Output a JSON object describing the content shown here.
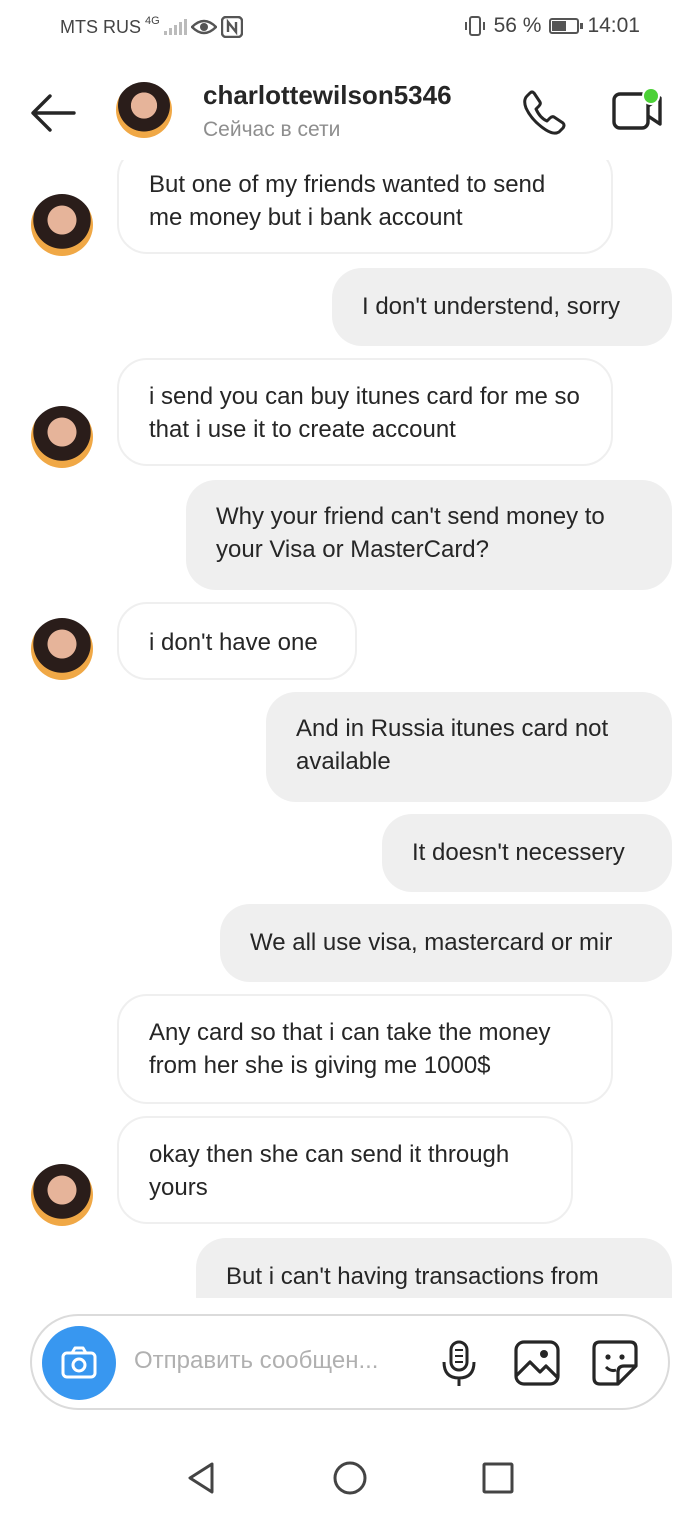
{
  "status_bar": {
    "carrier": "MTS RUS",
    "network": "4G",
    "battery": "56 %",
    "battery_level": 0.56,
    "time": "14:01"
  },
  "header": {
    "username": "charlottewilson5346",
    "presence": "Сейчас в сети",
    "online_dot_color": "#4cd137"
  },
  "messages": [
    {
      "side": "in",
      "text": "But one of my friends wanted to send me money but i bank account",
      "avatar": true
    },
    {
      "side": "out",
      "text": "I don't understend, sorry"
    },
    {
      "side": "in",
      "text": "i send you can buy itunes card for me so that i use it to create account",
      "avatar": true
    },
    {
      "side": "out",
      "text": "Why your friend can't send money to your Visa or MasterCard?"
    },
    {
      "side": "in",
      "text": "i don't have one",
      "avatar": true
    },
    {
      "side": "out",
      "text": "And in Russia itunes card not available"
    },
    {
      "side": "out",
      "text": "It doesn't necessery"
    },
    {
      "side": "out",
      "text": "We all use visa, mastercard or mir"
    },
    {
      "side": "in",
      "text": "Any card so that i can take the money from her she is giving me 1000$",
      "avatar": false
    },
    {
      "side": "in",
      "text": "okay then she can send it through yours",
      "avatar": true
    },
    {
      "side": "out",
      "text": "But i can't having transactions from"
    }
  ],
  "composer": {
    "placeholder": "Отправить сообщен...",
    "value": "",
    "camera_color": "#3897f0"
  },
  "icons": {
    "back": "arrow-left-icon",
    "call": "phone-icon",
    "video": "video-camera-icon",
    "camera": "camera-icon",
    "mic": "microphone-icon",
    "gallery": "image-icon",
    "sticker": "sticker-icon",
    "nav_back": "triangle-back-icon",
    "nav_home": "circle-home-icon",
    "nav_recent": "square-recent-icon"
  }
}
